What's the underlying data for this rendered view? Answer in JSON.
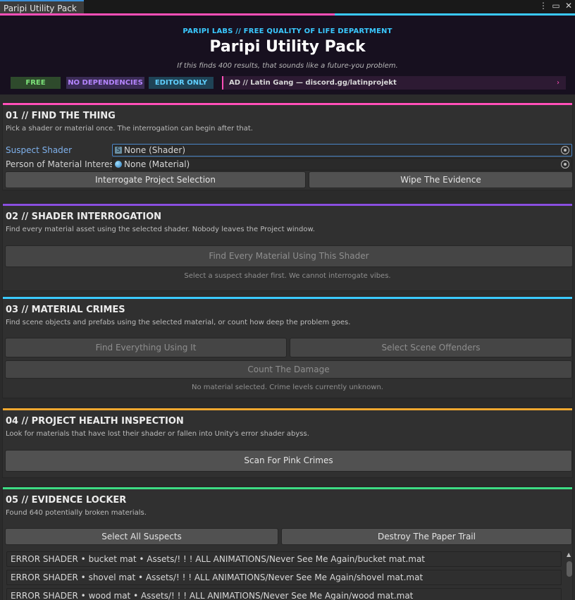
{
  "window": {
    "tab_label": "Paripi Utility Pack",
    "controls": [
      "⋮",
      "▭",
      "✕"
    ]
  },
  "header": {
    "kicker": "PARIPI LABS // FREE QUALITY OF LIFE DEPARTMENT",
    "title": "Paripi Utility Pack",
    "tagline": "If this finds 400 results, that sounds like a future-you problem.",
    "badges": [
      "FREE",
      "NO DEPENDENCIES",
      "EDITOR ONLY"
    ],
    "ad_text": "AD // Latin Gang — discord.gg/latinprojekt",
    "ad_chevron": "›"
  },
  "colors": {
    "pink": "#ff4fb8",
    "cyan": "#3ac9ff",
    "purple": "#8a4fe0",
    "orange": "#f0a830",
    "green": "#3ddc84"
  },
  "sections": {
    "find": {
      "title": "01 // FIND THE THING",
      "desc": "Pick a shader or material once. The interrogation can begin after that.",
      "shader_label": "Suspect Shader",
      "shader_value": "None (Shader)",
      "material_label": "Person of Material Interest",
      "material_value": "None (Material)",
      "interrogate_button": "Interrogate Project Selection",
      "wipe_button": "Wipe The Evidence"
    },
    "shader": {
      "title": "02 // SHADER INTERROGATION",
      "desc": "Find every material asset using the selected shader. Nobody leaves the Project window.",
      "find_button": "Find Every Material Using This Shader",
      "hint": "Select a suspect shader first. We cannot interrogate vibes."
    },
    "material": {
      "title": "03 // MATERIAL CRIMES",
      "desc": "Find scene objects and prefabs using the selected material, or count how deep the problem goes.",
      "find_button": "Find Everything Using It",
      "select_button": "Select Scene Offenders",
      "count_button": "Count The Damage",
      "hint": "No material selected. Crime levels currently unknown."
    },
    "health": {
      "title": "04 // PROJECT HEALTH INSPECTION",
      "desc": "Look for materials that have lost their shader or fallen into Unity's error shader abyss.",
      "scan_button": "Scan For Pink Crimes"
    },
    "evidence": {
      "title": "05 // EVIDENCE LOCKER",
      "desc": "Found 640 potentially broken materials.",
      "select_button": "Select All Suspects",
      "destroy_button": "Destroy The Paper Trail",
      "rows": [
        "ERROR SHADER • bucket mat • Assets/! ! ! ALL ANIMATIONS/Never See Me Again/bucket mat.mat",
        "ERROR SHADER • shovel mat • Assets/! ! ! ALL ANIMATIONS/Never See Me Again/shovel mat.mat",
        "ERROR SHADER • wood mat • Assets/! ! ! ALL ANIMATIONS/Never See Me Again/wood mat.mat"
      ]
    }
  }
}
